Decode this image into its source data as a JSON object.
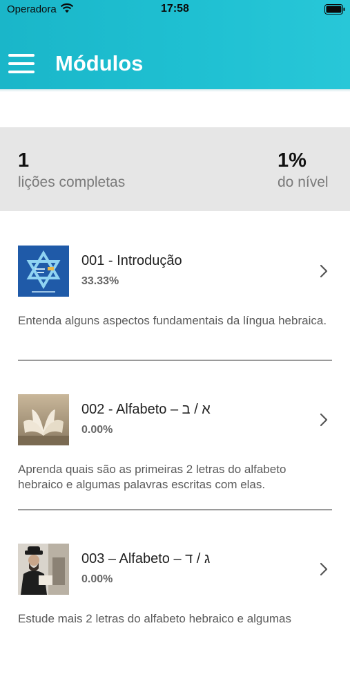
{
  "status_bar": {
    "carrier": "Operadora",
    "time": "17:58"
  },
  "header": {
    "title": "Módulos"
  },
  "stats": {
    "left": {
      "value": "1",
      "label": "lições completas"
    },
    "right": {
      "value": "1%",
      "label": "do nível"
    }
  },
  "modules": [
    {
      "title": "001 - Introdução",
      "percent": "33.33%",
      "description": "Entenda alguns aspectos fundamentais da língua hebraica."
    },
    {
      "title": "002 - Alfabeto – א / ב",
      "percent": "0.00%",
      "description": "Aprenda quais são as primeiras 2 letras do alfabeto hebraico e algumas palavras escritas com elas."
    },
    {
      "title": "003 – Alfabeto – ג / ד",
      "percent": "0.00%",
      "description": "Estude mais 2 letras do alfabeto hebraico e algumas"
    }
  ],
  "colors": {
    "header": "#1fc0d2",
    "stats_bg": "#e6e6e6"
  },
  "icons": [
    "menu-icon",
    "wifi-icon",
    "battery-icon",
    "chevron-right-icon",
    "star-of-david-icon"
  ]
}
